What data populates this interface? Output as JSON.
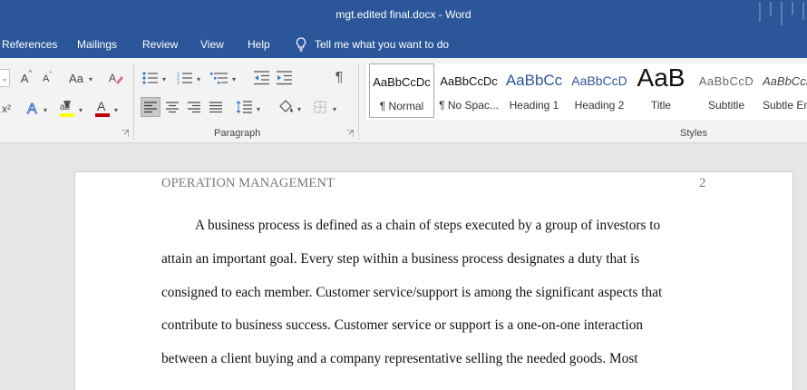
{
  "window": {
    "title": "mgt.edited final.docx  -  Word"
  },
  "menu": {
    "tabs": [
      "References",
      "Mailings",
      "Review",
      "View",
      "Help"
    ],
    "tell_me": "Tell me what you want to do"
  },
  "ribbon": {
    "groups": {
      "paragraph": "Paragraph",
      "styles": "Styles"
    },
    "styles": [
      {
        "sample": "AaBbCcDc",
        "name": "¶ Normal"
      },
      {
        "sample": "AaBbCcDc",
        "name": "¶ No Spac..."
      },
      {
        "sample": "AaBbCc",
        "name": "Heading 1"
      },
      {
        "sample": "AaBbCcD",
        "name": "Heading 2"
      },
      {
        "sample": "AaB",
        "name": "Title"
      },
      {
        "sample": "AaBbCcD",
        "name": "Subtitle"
      },
      {
        "sample": "AaBbCcDc",
        "name": "Subtle Em"
      }
    ],
    "colors": {
      "highlight": "#ffff00",
      "font_color": "#c00000",
      "accent": "#2b579a"
    }
  },
  "document": {
    "running_head": "OPERATION MANAGEMENT",
    "page_number": "2",
    "lines": [
      "A business process is defined as a chain of steps executed by a group of investors to",
      "attain an important goal. Every step within a business process designates a duty that is",
      "consigned to each member. Customer service/support is among the significant aspects that",
      "contribute to business success. Customer service or support is a one-on-one interaction",
      "between a client buying and a company representative selling the needed goods. Most"
    ]
  }
}
